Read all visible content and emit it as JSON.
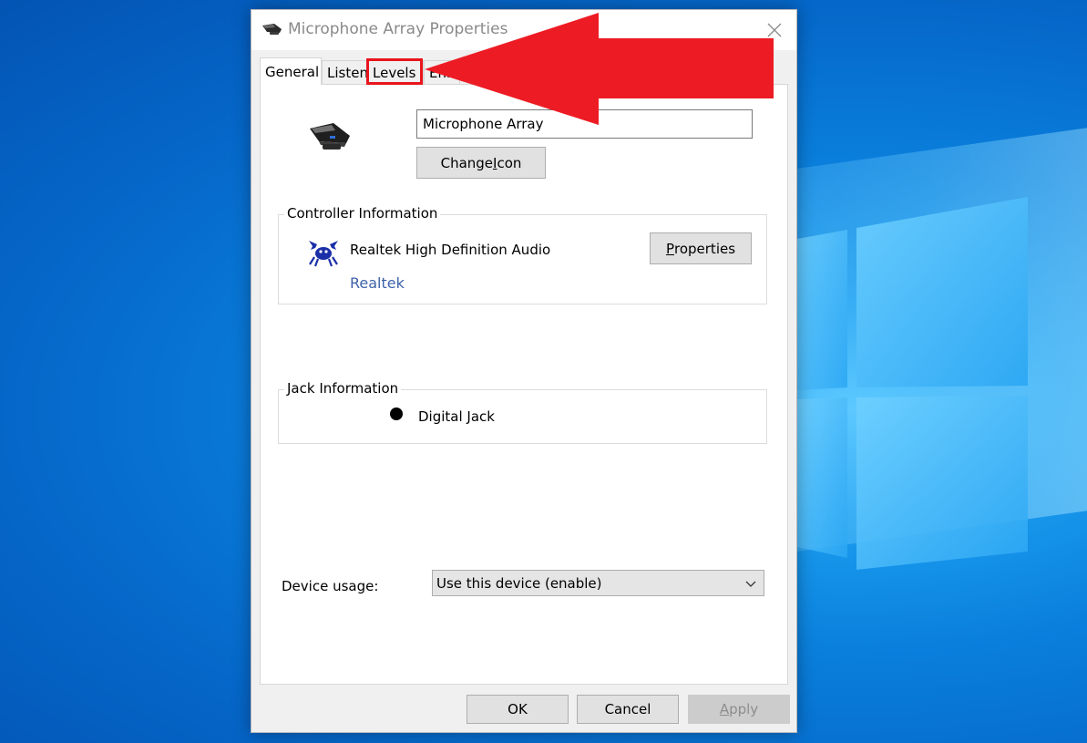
{
  "window": {
    "title": "Microphone Array Properties",
    "close_glyph": "✕"
  },
  "tabs": [
    {
      "label": "General",
      "active": true
    },
    {
      "label": "Listen",
      "active": false
    },
    {
      "label": "Levels",
      "active": false,
      "highlighted": true
    },
    {
      "label": "Enhancements",
      "active": false,
      "partially_hidden": true
    }
  ],
  "general": {
    "device_name": "Microphone Array",
    "change_icon_label_pre": "Change ",
    "change_icon_label_ul": "I",
    "change_icon_label_post": "con",
    "controller": {
      "group_label": "Controller Information",
      "name": "Realtek High Definition Audio",
      "vendor": "Realtek",
      "properties_label_ul": "P",
      "properties_label_post": "roperties"
    },
    "jack": {
      "group_label": "Jack Information",
      "name": "Digital Jack"
    },
    "usage": {
      "label": "Device usage:",
      "selected": "Use this device (enable)"
    }
  },
  "footer": {
    "ok_label": "OK",
    "cancel_label": "Cancel",
    "apply_label_ul": "A",
    "apply_label_post": "pply"
  },
  "annotation": {
    "arrow_color": "#ed1c24",
    "box_color": "#e8141c"
  },
  "icons": {
    "title": "microphone-array-icon",
    "device": "microphone-array-icon",
    "controller": "realtek-crab-icon",
    "jack": "jack-dot-icon",
    "dropdown": "chevron-down-icon",
    "close": "close-icon"
  }
}
